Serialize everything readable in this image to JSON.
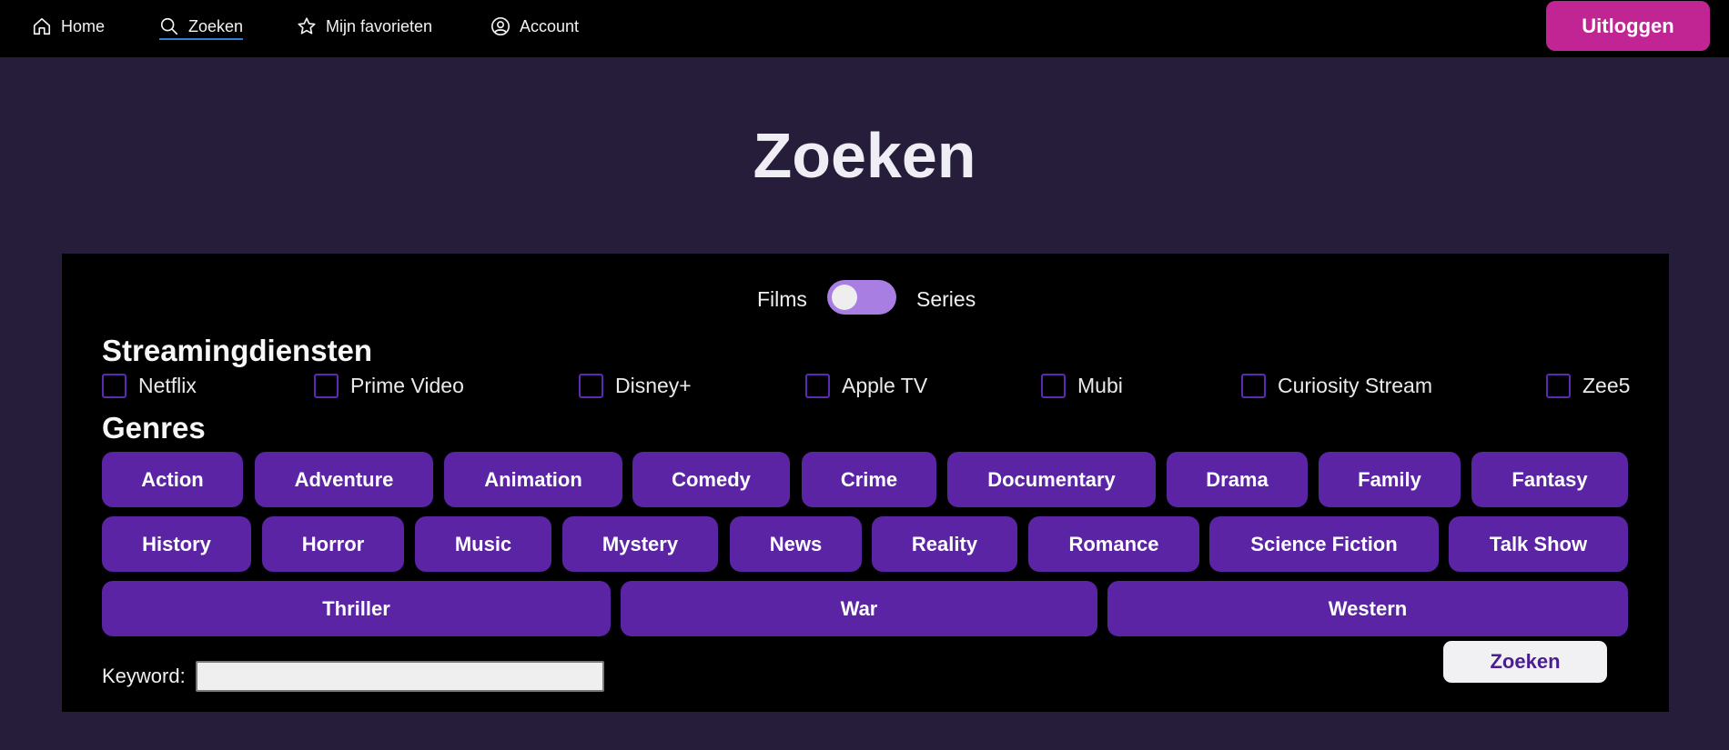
{
  "nav": {
    "items": [
      {
        "label": "Home",
        "icon": "home-icon"
      },
      {
        "label": "Zoeken",
        "icon": "search-icon",
        "active": true
      },
      {
        "label": "Mijn favorieten",
        "icon": "star-icon"
      },
      {
        "label": "Account",
        "icon": "account-icon"
      }
    ],
    "logout_label": "Uitloggen"
  },
  "page": {
    "title": "Zoeken"
  },
  "toggle": {
    "left_label": "Films",
    "right_label": "Series",
    "selected": "Films"
  },
  "streaming": {
    "heading": "Streamingdiensten",
    "services": [
      "Netflix",
      "Prime Video",
      "Disney+",
      "Apple TV",
      "Mubi",
      "Curiosity Stream",
      "Zee5"
    ]
  },
  "genres": {
    "heading": "Genres",
    "items": [
      "Action",
      "Adventure",
      "Animation",
      "Comedy",
      "Crime",
      "Documentary",
      "Drama",
      "Family",
      "Fantasy",
      "History",
      "Horror",
      "Music",
      "Mystery",
      "News",
      "Reality",
      "Romance",
      "Science Fiction",
      "Talk Show",
      "Thriller",
      "War",
      "Western"
    ]
  },
  "keyword": {
    "label": "Keyword:",
    "value": ""
  },
  "search_button": "Zoeken",
  "colors": {
    "accent": "#5b24a4",
    "logout": "#c12594",
    "toggle": "#a97ee2",
    "background": "#251d3a"
  }
}
